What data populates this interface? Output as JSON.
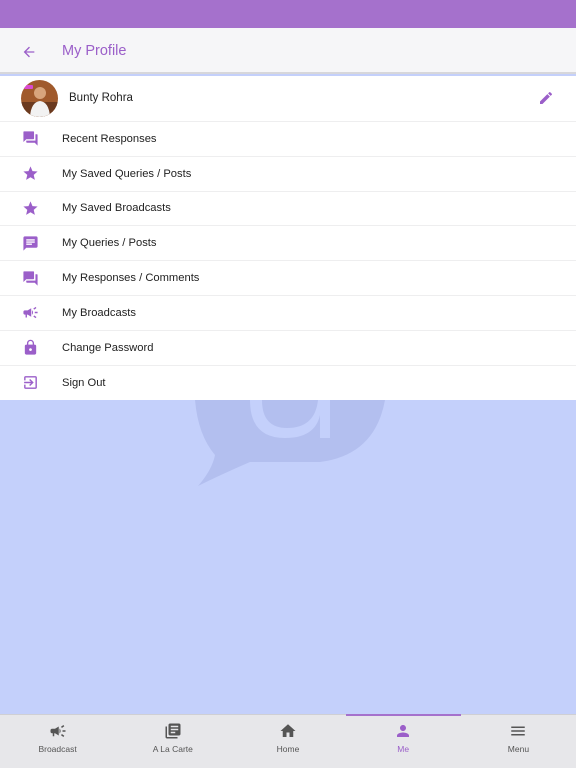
{
  "header": {
    "title": "My Profile"
  },
  "profile": {
    "name": "Bunty Rohra"
  },
  "menu": {
    "items": [
      {
        "label": "Recent Responses",
        "icon": "forum-icon"
      },
      {
        "label": "My Saved Queries / Posts",
        "icon": "star-icon"
      },
      {
        "label": "My Saved Broadcasts",
        "icon": "star-icon"
      },
      {
        "label": "My Queries / Posts",
        "icon": "message-icon"
      },
      {
        "label": "My Responses / Comments",
        "icon": "forum-icon"
      },
      {
        "label": "My Broadcasts",
        "icon": "megaphone-icon"
      },
      {
        "label": "Change Password",
        "icon": "lock-icon"
      },
      {
        "label": "Sign Out",
        "icon": "sign-out-icon"
      }
    ]
  },
  "tabs": [
    {
      "label": "Broadcast",
      "icon": "megaphone-icon"
    },
    {
      "label": "A La Carte",
      "icon": "newspaper-icon"
    },
    {
      "label": "Home",
      "icon": "home-icon"
    },
    {
      "label": "Me",
      "icon": "person-icon",
      "active": true
    },
    {
      "label": "Menu",
      "icon": "hamburger-icon"
    }
  ],
  "colors": {
    "accent": "#a571cc",
    "accent_text": "#9b5fc9",
    "background": "#c4d0fb",
    "tab_bar": "#e7e7ea"
  }
}
